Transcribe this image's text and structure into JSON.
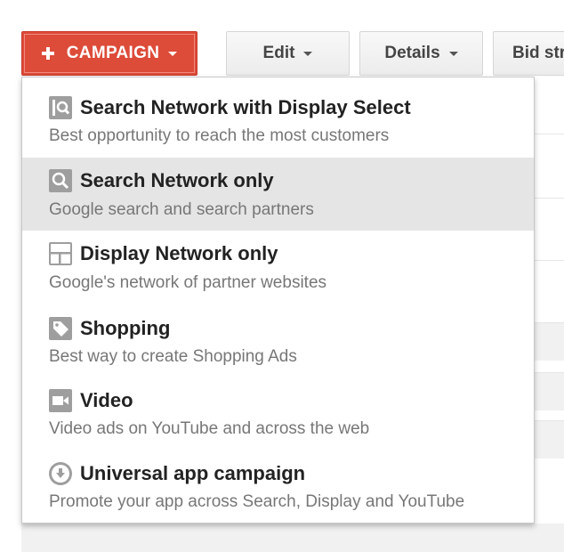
{
  "toolbar": {
    "campaign_label": "CAMPAIGN",
    "edit_label": "Edit",
    "details_label": "Details",
    "bid_label": "Bid str"
  },
  "menu": {
    "items": [
      {
        "title": "Search Network with Display Select",
        "description": "Best opportunity to reach the most customers",
        "icon": "search-display-icon"
      },
      {
        "title": "Search Network only",
        "description": "Google search and search partners",
        "icon": "search-icon",
        "highlighted": true
      },
      {
        "title": "Display Network only",
        "description": "Google's network of partner websites",
        "icon": "display-icon"
      },
      {
        "title": "Shopping",
        "description": "Best way to create Shopping Ads",
        "icon": "tag-icon"
      },
      {
        "title": "Video",
        "description": "Video ads on YouTube and across the web",
        "icon": "video-camera-icon"
      },
      {
        "title": "Universal app campaign",
        "description": "Promote your app across Search, Display and YouTube",
        "icon": "download-icon"
      }
    ]
  },
  "colors": {
    "campaign_button": "#dd4b39",
    "highlight": "#e5e5e5",
    "icon": "#9e9e9e"
  }
}
